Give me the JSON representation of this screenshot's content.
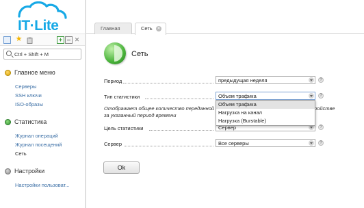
{
  "brand": {
    "logo_text": "IT·Lite",
    "accent": "#17a9e6"
  },
  "toolbar": {
    "icons": [
      "sidebar-toggle-icon",
      "star-icon",
      "clipboard-icon",
      "add-icon",
      "minimize-icon",
      "pin-icon"
    ]
  },
  "search": {
    "placeholder": "Ctrl + Shift + M"
  },
  "sidebar": {
    "sections": [
      {
        "label": "Главное меню",
        "icon": "home-icon",
        "items": [
          "Серверы",
          "SSH ключи",
          "ISO-образы"
        ]
      },
      {
        "label": "Статистика",
        "icon": "statistics-icon",
        "items": [
          "Журнал операций",
          "Журнал посещений",
          "Сеть"
        ],
        "active_item": "Сеть"
      },
      {
        "label": "Настройки",
        "icon": "settings-icon",
        "items": [
          "Настройки пользоват..."
        ]
      }
    ]
  },
  "tabs": [
    {
      "label": "Главная",
      "active": false
    },
    {
      "label": "Сеть",
      "active": true,
      "closable": true
    }
  ],
  "page": {
    "title": "Сеть",
    "icon": "network-stats-icon"
  },
  "form": {
    "period": {
      "label": "Период",
      "value": "предыдущая неделя"
    },
    "stat_type": {
      "label": "Тип статистики",
      "value": "Объем трафика",
      "options": [
        "Объем трафика",
        "Нагрузка на канал",
        "Нагрузка (Burstable)"
      ]
    },
    "description": "Отображает общее количество переданной и полученной информации сервером или устройством за указанный период времени",
    "description_visible_left": "Отображает общее количество переданной и",
    "description_visible_right": "ройстве",
    "description_line2": "за указанный период времени",
    "target": {
      "label": "Цель статистики",
      "value": "Сервер"
    },
    "server": {
      "label": "Сервер",
      "value": "Все серверы"
    },
    "help_symbol": "?",
    "ok_label": "Ok"
  }
}
